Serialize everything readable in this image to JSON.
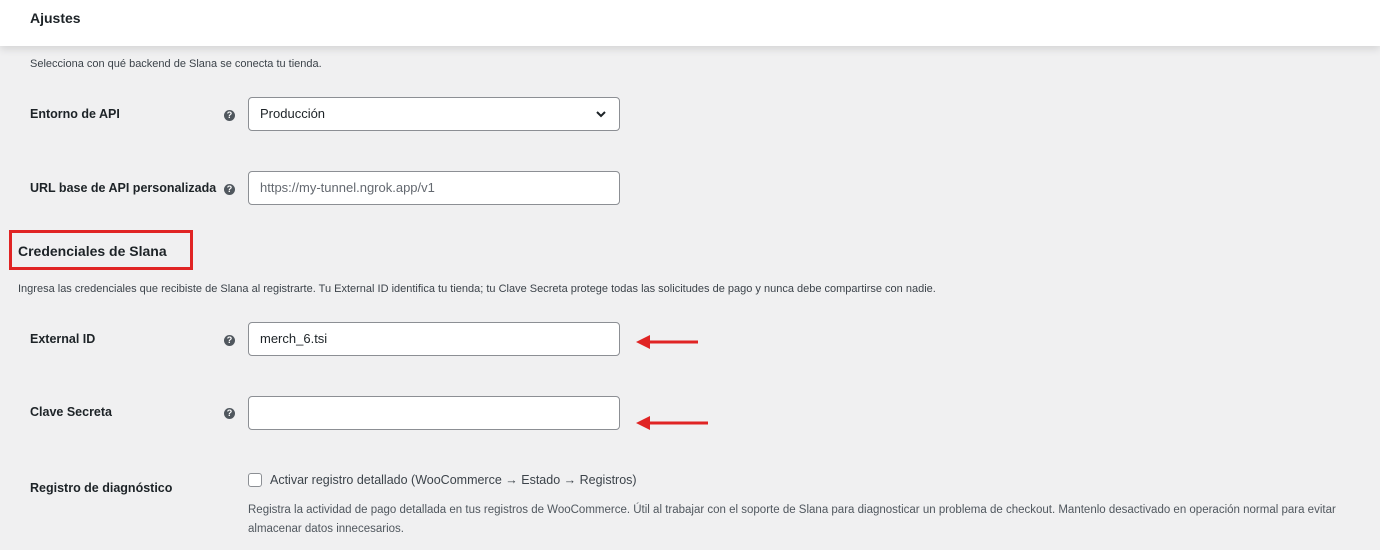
{
  "header": {
    "title": "Ajustes"
  },
  "intro": "Selecciona con qué backend de Slana se conecta tu tienda.",
  "fields": {
    "api_env": {
      "label": "Entorno de API",
      "value": "Producción"
    },
    "custom_url": {
      "label": "URL base de API personalizada",
      "placeholder": "https://my-tunnel.ngrok.app/v1"
    },
    "external_id": {
      "label": "External ID",
      "value": "merch_6.tsi"
    },
    "secret": {
      "label": "Clave Secreta",
      "value": ""
    },
    "debug": {
      "label": "Registro de diagnóstico",
      "checkbox_label": "Activar registro detallado (WooCommerce → Estado → Registros)",
      "checked": false,
      "description": "Registra la actividad de pago detallada en tus registros de WooCommerce. Útil al trabajar con el soporte de Slana para diagnosticar un problema de checkout. Mantenlo desactivado en operación normal para evitar almacenar datos innecesarios."
    }
  },
  "credentials": {
    "title": "Credenciales de Slana",
    "description": "Ingresa las credenciales que recibiste de Slana al registrarte. Tu External ID identifica tu tienda; tu Clave Secreta protege todas las solicitudes de pago y nunca debe compartirse con nadie."
  },
  "icons": {
    "help": "help-icon",
    "select": "chevron-down-icon",
    "annotation": "red-arrow-icon"
  },
  "colors": {
    "annotation": "#e02424",
    "background": "#f0f0f1"
  }
}
